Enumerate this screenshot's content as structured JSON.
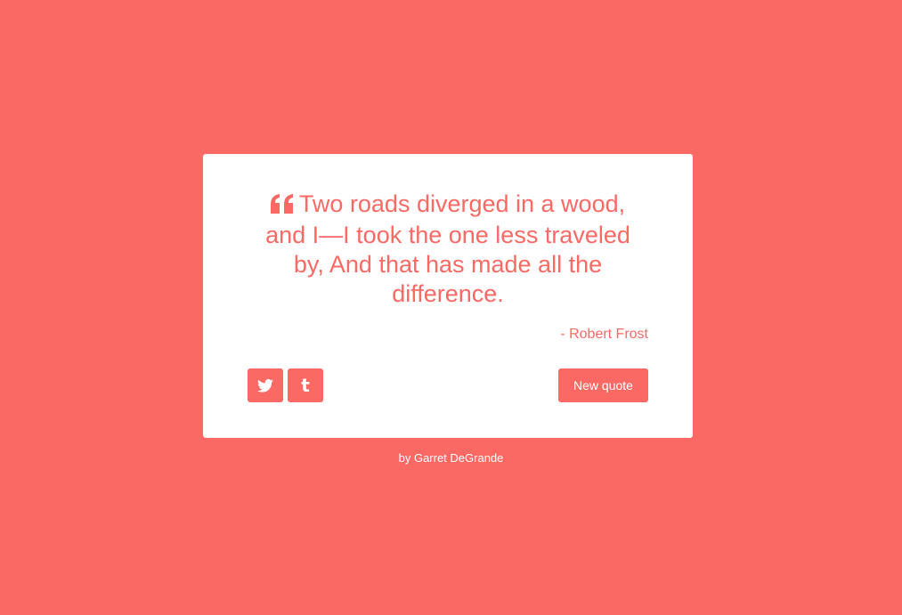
{
  "quote": {
    "text": "Two roads diverged in a wood, and I—I took the one less traveled by, And that has made all the difference.",
    "author": "- Robert Frost",
    "icon": "quote-left-icon"
  },
  "buttons": {
    "twitter_icon": "twitter-icon",
    "tumblr_icon": "tumblr-icon",
    "tumblr_glyph": "t",
    "new_quote": "New quote"
  },
  "footer": {
    "credit": "by Garret DeGrande"
  },
  "colors": {
    "accent": "#fb6964",
    "card": "#ffffff"
  }
}
